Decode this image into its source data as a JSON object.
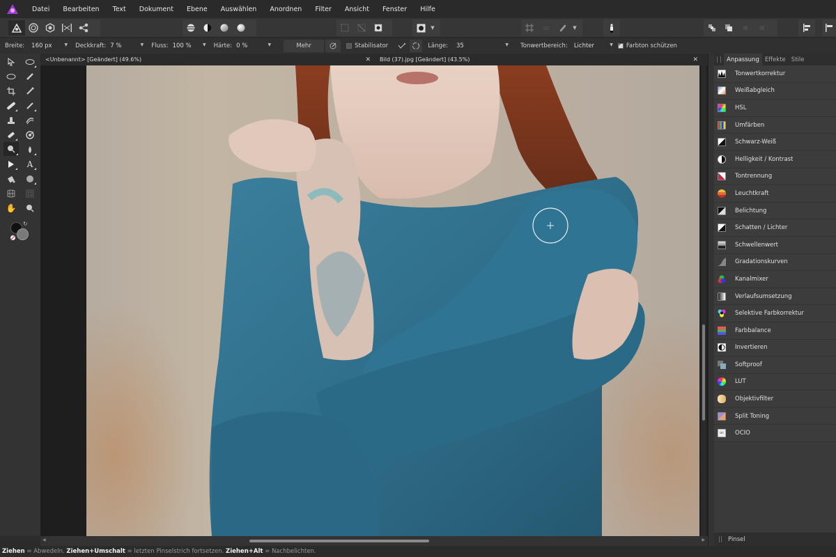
{
  "menu": [
    "Datei",
    "Bearbeiten",
    "Text",
    "Dokument",
    "Ebene",
    "Auswählen",
    "Anordnen",
    "Filter",
    "Ansicht",
    "Fenster",
    "Hilfe"
  ],
  "toolbar": {
    "persona_icons": [
      "photo-persona-icon",
      "liquify-persona-icon",
      "develop-persona-icon",
      "tone-mapping-persona-icon",
      "export-persona-icon"
    ],
    "view_icons": [
      "levels-icon",
      "contrast-icon",
      "sphere-half-icon",
      "sphere-icon"
    ],
    "selection_icons": [
      "marquee-icon",
      "no-selection-icon",
      "invert-selection-icon"
    ],
    "mask_icon": "quick-mask-icon",
    "snap_icons": [
      "grid-snap-icon",
      "align-icon",
      "link-icon"
    ],
    "assistant_icon": "assistant-icon",
    "arrange_icons": [
      "arrange-back-icon",
      "arrange-front-icon",
      "arrange-disabled-1-icon",
      "arrange-disabled-2-icon"
    ],
    "align_icons": [
      "align-left-icon",
      "align-right-icon"
    ]
  },
  "context": {
    "breite_label": "Breite:",
    "breite_value": "160 px",
    "deckkraft_label": "Deckkraft:",
    "deckkraft_value": "7 %",
    "fluss_label": "Fluss:",
    "fluss_value": "100 %",
    "haerte_label": "Härte:",
    "haerte_value": "0 %",
    "mehr_label": "Mehr",
    "stabilisator_label": "Stabilisator",
    "stabilisator_checked": false,
    "laenge_label": "Länge:",
    "laenge_value": "35",
    "tonwert_label": "Tonwertbereich:",
    "tonwert_value": "Lichter",
    "farbton_label": "Farbton schützen",
    "farbton_checked": true
  },
  "documents": [
    {
      "title": "<Unbenannt> [Geändert] (49.6%)"
    },
    {
      "title": "Bild (37).jpg [Geändert] (43.5%)"
    }
  ],
  "panel": {
    "tabs": [
      "Anpassung",
      "Effekte",
      "Stile"
    ],
    "active_tab": "Anpassung",
    "adjustments": [
      {
        "label": "Tonwertkorrektur",
        "icon": "levels-icon"
      },
      {
        "label": "Weißabgleich",
        "icon": "white-balance-icon"
      },
      {
        "label": "HSL",
        "icon": "hsl-icon"
      },
      {
        "label": "Umfärben",
        "icon": "recolor-icon"
      },
      {
        "label": "Schwarz-Weiß",
        "icon": "black-white-icon"
      },
      {
        "label": "Helligkeit / Kontrast",
        "icon": "brightness-contrast-icon"
      },
      {
        "label": "Tontrennung",
        "icon": "posterize-icon"
      },
      {
        "label": "Leuchtkraft",
        "icon": "vibrance-icon"
      },
      {
        "label": "Belichtung",
        "icon": "exposure-icon"
      },
      {
        "label": "Schatten / Lichter",
        "icon": "shadows-highlights-icon"
      },
      {
        "label": "Schwellenwert",
        "icon": "threshold-icon"
      },
      {
        "label": "Gradationskurven",
        "icon": "curves-icon"
      },
      {
        "label": "Kanalmixer",
        "icon": "channel-mixer-icon"
      },
      {
        "label": "Verlaufsumsetzung",
        "icon": "gradient-map-icon"
      },
      {
        "label": "Selektive Farbkorrektur",
        "icon": "selective-color-icon"
      },
      {
        "label": "Farbbalance",
        "icon": "color-balance-icon"
      },
      {
        "label": "Invertieren",
        "icon": "invert-icon"
      },
      {
        "label": "Softproof",
        "icon": "soft-proof-icon"
      },
      {
        "label": "LUT",
        "icon": "lut-icon"
      },
      {
        "label": "Objektivfilter",
        "icon": "lens-filter-icon"
      },
      {
        "label": "Split Toning",
        "icon": "split-toning-icon"
      },
      {
        "label": "OCIO",
        "icon": "ocio-icon"
      }
    ],
    "bottom_panel": "Pinsel"
  },
  "status": {
    "k1": "Ziehen",
    "t1": " = Abwedeln. ",
    "k2": "Ziehen+Umschalt",
    "t2": " = letzten Pinselstrich fortsetzen. ",
    "k3": "Ziehen+Alt",
    "t3": " = Nachbelichten."
  },
  "colors": {
    "accent": "#9b3fd2",
    "shirt": "#2e6e8a",
    "hair": "#7a3a22"
  }
}
